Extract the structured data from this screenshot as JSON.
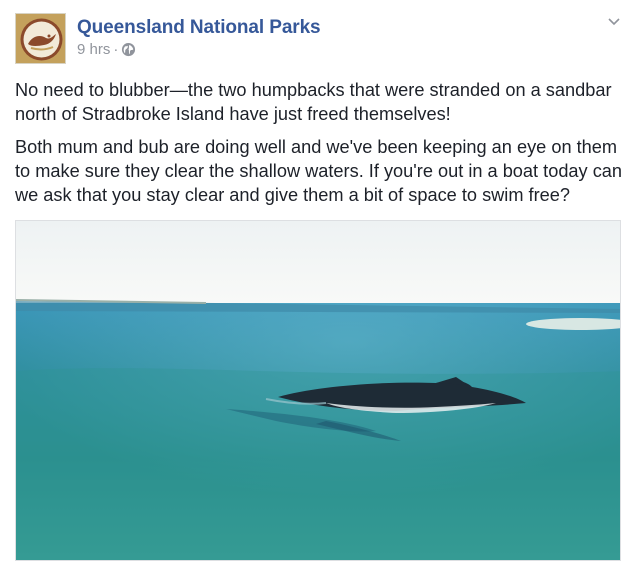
{
  "post": {
    "page_name": "Queensland National Parks",
    "time": "9 hrs",
    "separator": "·",
    "privacy_icon": "globe-icon",
    "menu_icon": "chevron-down-icon",
    "paragraphs": [
      "No need to blubber—the two humpbacks that were stranded on a sandbar north of Stradbroke Island have just freed themselves!",
      "Both mum and bub are doing well and we've been keeping an eye on them to make sure they clear the shallow waters. If you're out in a boat today can we ask that you stay clear and give them a bit of space to swim free?"
    ],
    "media_icon": "humpback-whale-image"
  },
  "colors": {
    "link": "#365899",
    "meta": "#90949c",
    "text": "#1d2129",
    "sea": "#2f8f96",
    "sky": "#f6f8f7"
  }
}
